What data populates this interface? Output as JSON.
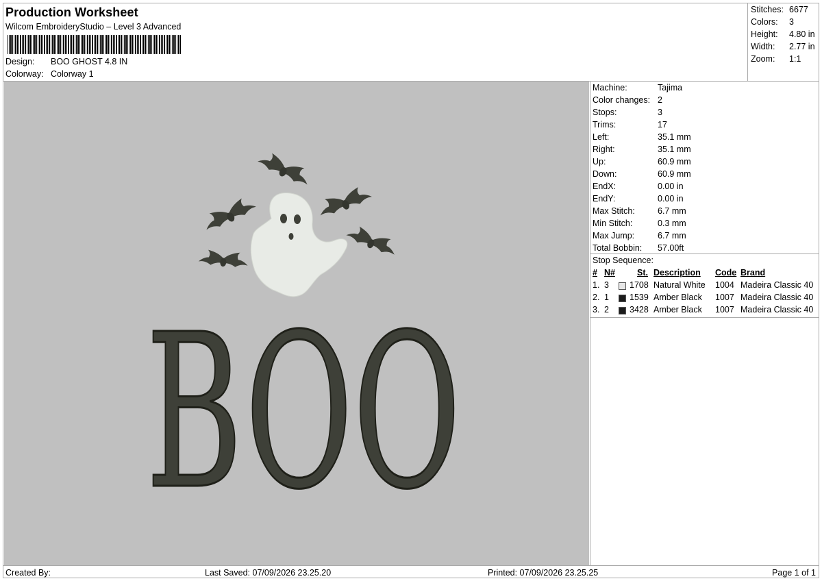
{
  "header": {
    "title": "Production Worksheet",
    "subtitle": "Wilcom EmbroideryStudio – Level 3 Advanced",
    "design_label": "Design:",
    "design_value": "BOO GHOST 4.8 IN",
    "colorway_label": "Colorway:",
    "colorway_value": "Colorway 1"
  },
  "summary": [
    {
      "label": "Stitches:",
      "value": "6677"
    },
    {
      "label": "Colors:",
      "value": "3"
    },
    {
      "label": "Height:",
      "value": "4.80 in"
    },
    {
      "label": "Width:",
      "value": "2.77 in"
    },
    {
      "label": "Zoom:",
      "value": "1:1"
    }
  ],
  "details": [
    {
      "label": "Machine:",
      "value": "Tajima"
    },
    {
      "label": "Color changes:",
      "value": "2"
    },
    {
      "label": "Stops:",
      "value": "3"
    },
    {
      "label": "Trims:",
      "value": "17"
    },
    {
      "label": "Left:",
      "value": "35.1 mm"
    },
    {
      "label": "Right:",
      "value": "35.1 mm"
    },
    {
      "label": "Up:",
      "value": "60.9 mm"
    },
    {
      "label": "Down:",
      "value": "60.9 mm"
    },
    {
      "label": "EndX:",
      "value": "0.00 in"
    },
    {
      "label": "EndY:",
      "value": "0.00 in"
    },
    {
      "label": "Max Stitch:",
      "value": "6.7 mm"
    },
    {
      "label": "Min Stitch:",
      "value": "0.3 mm"
    },
    {
      "label": "Max Jump:",
      "value": "6.7 mm"
    },
    {
      "label": "Total Bobbin:",
      "value": "57.00ft"
    }
  ],
  "stop_sequence": {
    "label": "Stop Sequence:",
    "headers": {
      "num": "#",
      "n": "N#",
      "st": "St.",
      "desc": "Description",
      "code": "Code",
      "brand": "Brand"
    },
    "rows": [
      {
        "num": "1.",
        "n": "3",
        "color": "#e6e6e6",
        "st": "1708",
        "desc": "Natural White",
        "code": "1004",
        "brand": "Madeira Classic 40"
      },
      {
        "num": "2.",
        "n": "1",
        "color": "#1c1c1c",
        "st": "1539",
        "desc": "Amber Black",
        "code": "1007",
        "brand": "Madeira Classic 40"
      },
      {
        "num": "3.",
        "n": "2",
        "color": "#1c1c1c",
        "st": "3428",
        "desc": "Amber Black",
        "code": "1007",
        "brand": "Madeira Classic 40"
      }
    ]
  },
  "design_preview": {
    "text": "BOO",
    "background": "#c0c0c0",
    "ghost_color": "#e8ebe6",
    "dark_color": "#3e4038"
  },
  "footer": {
    "created_by": "Created By:",
    "last_saved": "Last Saved: 07/09/2026 23.25.20",
    "printed": "Printed: 07/09/2026 23.25.25",
    "page": "Page 1 of 1"
  }
}
